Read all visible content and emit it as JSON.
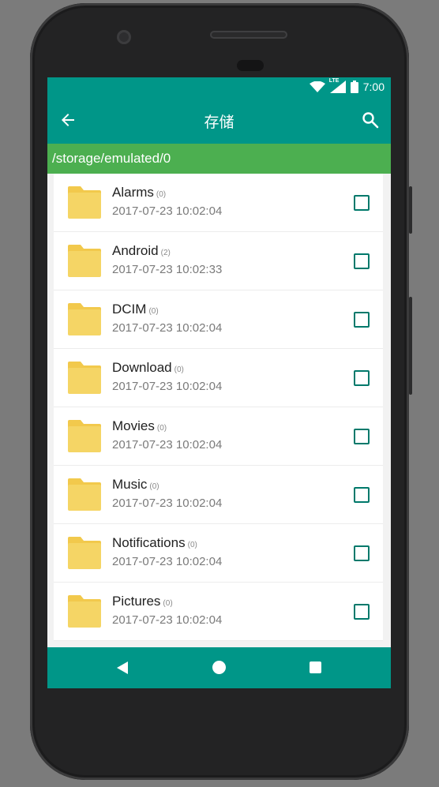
{
  "status_bar": {
    "time": "7:00",
    "lte_label": "LTE",
    "icons": [
      "wifi-icon",
      "signal-icon",
      "battery-icon"
    ]
  },
  "app_bar": {
    "title": "存储",
    "back_icon": "arrow-back-icon",
    "search_icon": "search-icon"
  },
  "path": "/storage/emulated/0",
  "files": [
    {
      "name": "Alarms",
      "count": "(0)",
      "date": "2017-07-23 10:02:04",
      "checked": false
    },
    {
      "name": "Android",
      "count": "(2)",
      "date": "2017-07-23 10:02:33",
      "checked": false
    },
    {
      "name": "DCIM",
      "count": "(0)",
      "date": "2017-07-23 10:02:04",
      "checked": false
    },
    {
      "name": "Download",
      "count": "(0)",
      "date": "2017-07-23 10:02:04",
      "checked": false
    },
    {
      "name": "Movies",
      "count": "(0)",
      "date": "2017-07-23 10:02:04",
      "checked": false
    },
    {
      "name": "Music",
      "count": "(0)",
      "date": "2017-07-23 10:02:04",
      "checked": false
    },
    {
      "name": "Notifications",
      "count": "(0)",
      "date": "2017-07-23 10:02:04",
      "checked": false
    },
    {
      "name": "Pictures",
      "count": "(0)",
      "date": "2017-07-23 10:02:04",
      "checked": false
    }
  ],
  "nav_bar": {
    "icons": [
      "nav-back-icon",
      "nav-home-icon",
      "nav-recents-icon"
    ]
  },
  "colors": {
    "primary": "#009688",
    "path_bar": "#4caf50",
    "folder": "#f5d565",
    "checkbox": "#00796b"
  }
}
